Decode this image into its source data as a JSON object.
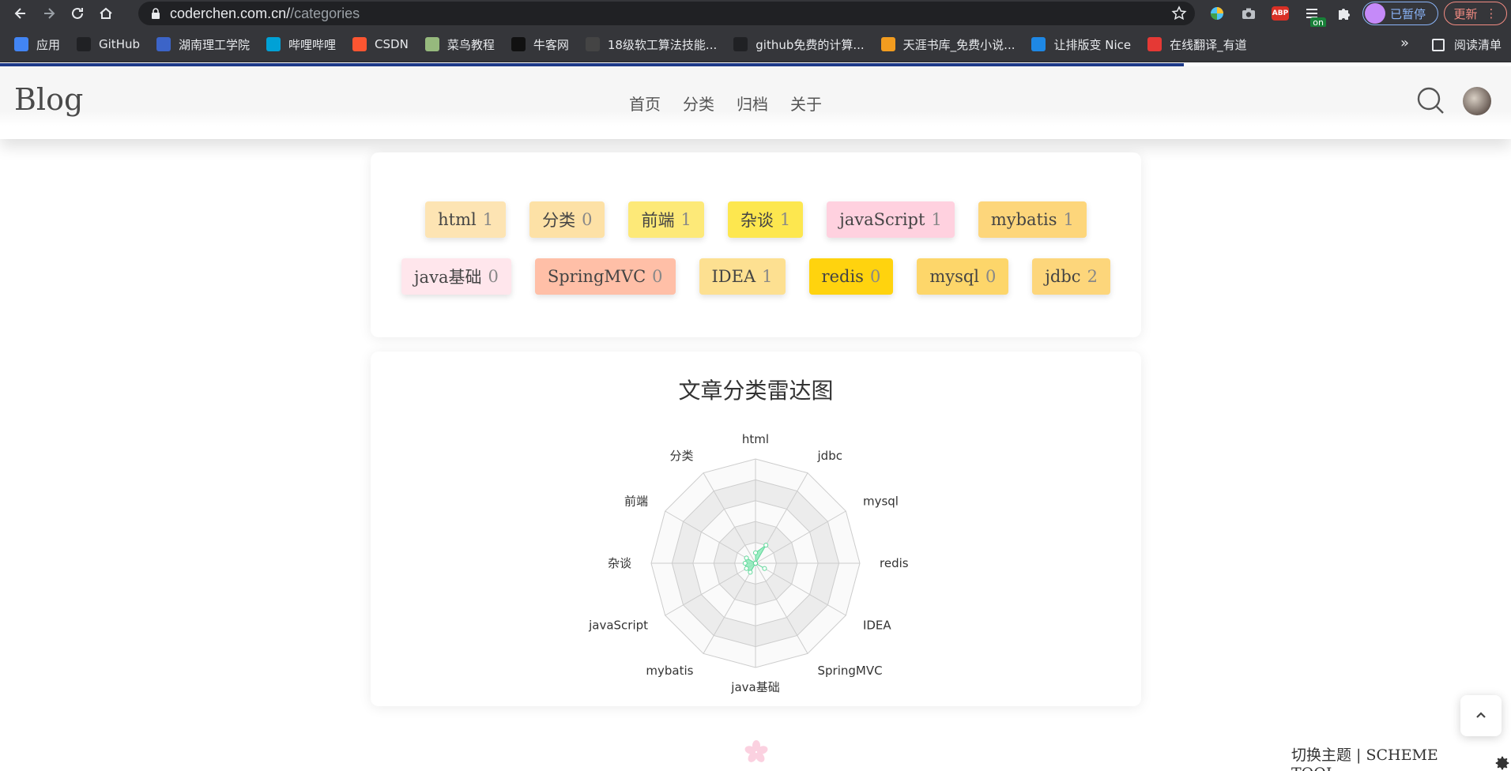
{
  "browser": {
    "url_host": "coderchen.com.cn/",
    "url_path": "/categories",
    "profile_label": "已暂停",
    "update_label": "更新",
    "extension_abp": "ABP",
    "extension_on": "on"
  },
  "bookmarks": [
    {
      "label": "应用",
      "icon": "apps-grid-icon",
      "color": "#4285f4"
    },
    {
      "label": "GitHub",
      "icon": "github-icon",
      "color": "#202124"
    },
    {
      "label": "湖南理工学院",
      "icon": "school-icon",
      "color": "#3c64c8"
    },
    {
      "label": "哔哩哔哩",
      "icon": "bilibili-icon",
      "color": "#00a1d6"
    },
    {
      "label": "CSDN",
      "icon": "csdn-icon",
      "color": "#fc5531"
    },
    {
      "label": "菜鸟教程",
      "icon": "runoob-icon",
      "color": "#96b97d"
    },
    {
      "label": "牛客网",
      "icon": "nowcoder-icon",
      "color": "#111111"
    },
    {
      "label": "18级软工算法技能...",
      "icon": "page-icon",
      "color": "#444444"
    },
    {
      "label": "github免费的计算...",
      "icon": "github-icon",
      "color": "#202124"
    },
    {
      "label": "天涯书库_免费小说...",
      "icon": "book-icon",
      "color": "#f29c1f"
    },
    {
      "label": "让排版变 Nice",
      "icon": "nice-icon",
      "color": "#1e88e5"
    },
    {
      "label": "在线翻译_有道",
      "icon": "youdao-icon",
      "color": "#e53935"
    }
  ],
  "reading_list": "阅读清单",
  "more_bookmarks": "»",
  "site": {
    "brand": "Blog",
    "menu": [
      "首页",
      "分类",
      "归档",
      "关于"
    ]
  },
  "tags_row1": [
    {
      "name": "html",
      "count": "1",
      "color": "#fde4b3"
    },
    {
      "name": "分类",
      "count": "0",
      "color": "#fde1a6"
    },
    {
      "name": "前端",
      "count": "1",
      "color": "#fde978"
    },
    {
      "name": "杂谈",
      "count": "1",
      "color": "#fde74f"
    },
    {
      "name": "javaScript",
      "count": "1",
      "color": "#ffd1df"
    },
    {
      "name": "mybatis",
      "count": "1",
      "color": "#fdd67b"
    }
  ],
  "tags_row2": [
    {
      "name": "java基础",
      "count": "0",
      "color": "#ffe6ec"
    },
    {
      "name": "SpringMVC",
      "count": "0",
      "color": "#ffbfa7"
    },
    {
      "name": "IDEA",
      "count": "1",
      "color": "#fde091"
    },
    {
      "name": "redis",
      "count": "0",
      "color": "#ffd30e"
    },
    {
      "name": "mysql",
      "count": "0",
      "color": "#fdd66a"
    },
    {
      "name": "jdbc",
      "count": "2",
      "color": "#fdd67b"
    }
  ],
  "chart_data": {
    "type": "radar",
    "title": "文章分类雷达图",
    "indicators": [
      "html",
      "jdbc",
      "mysql",
      "redis",
      "IDEA",
      "SpringMVC",
      "java基础",
      "mybatis",
      "javaScript",
      "杂谈",
      "前端",
      "分类"
    ],
    "values": [
      1,
      2,
      0,
      0,
      1,
      0,
      0,
      1,
      1,
      1,
      1,
      0
    ],
    "max": 10,
    "rings": 5,
    "fill_color": "#7de8b0",
    "line_color": "#5fd89a"
  },
  "footer": {
    "scheme_label": "切换主题 | SCHEME TOOL"
  }
}
